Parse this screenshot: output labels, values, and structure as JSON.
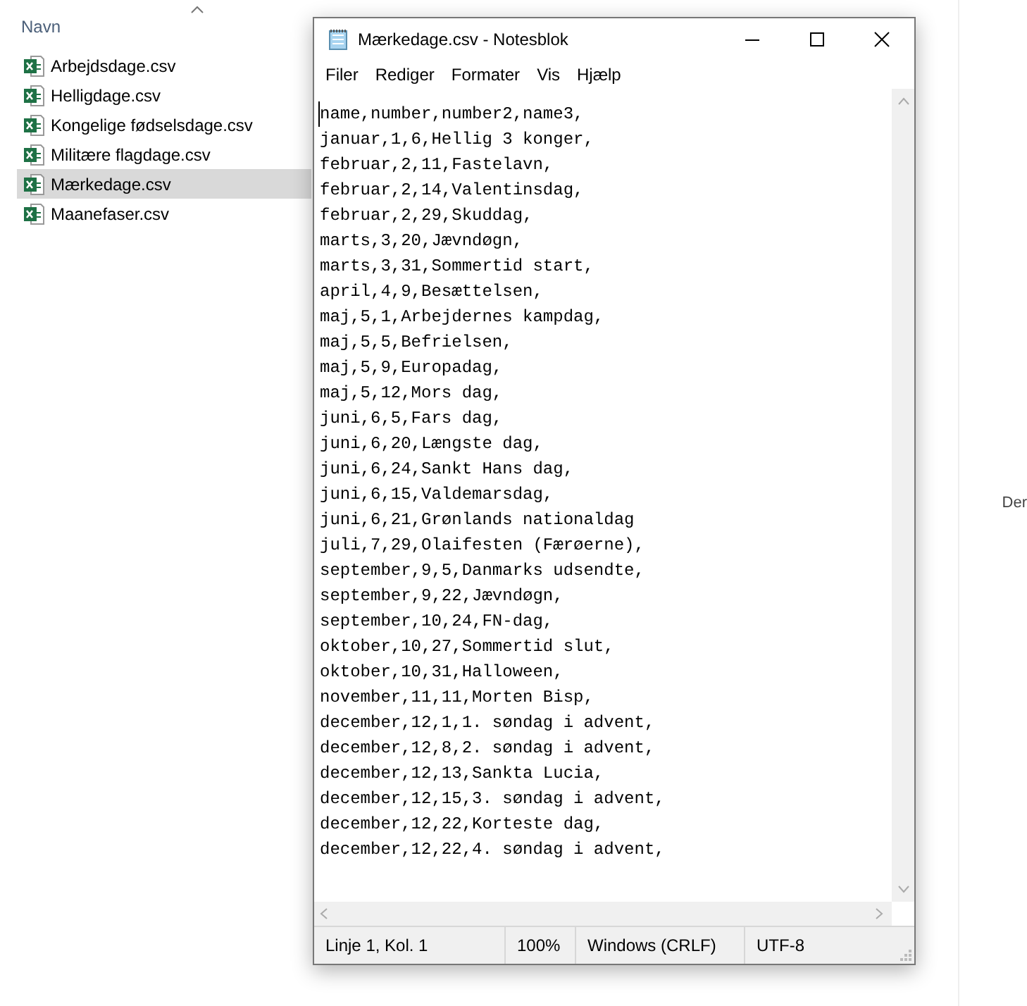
{
  "explorer": {
    "column_header": "Navn",
    "files": [
      {
        "name": "Arbejdsdage.csv",
        "selected": false
      },
      {
        "name": "Helligdage.csv",
        "selected": false
      },
      {
        "name": "Kongelige fødselsdage.csv",
        "selected": false
      },
      {
        "name": "Militære flagdage.csv",
        "selected": false
      },
      {
        "name": "Mærkedage.csv",
        "selected": true
      },
      {
        "name": "Maanefaser.csv",
        "selected": false
      }
    ],
    "preview_text": "Der"
  },
  "window": {
    "title": "Mærkedage.csv - Notesblok",
    "menu": [
      "Filer",
      "Rediger",
      "Formater",
      "Vis",
      "Hjælp"
    ],
    "lines": [
      "name,number,number2,name3,",
      "januar,1,6,Hellig 3 konger,",
      "februar,2,11,Fastelavn,",
      "februar,2,14,Valentinsdag,",
      "februar,2,29,Skuddag,",
      "marts,3,20,Jævndøgn,",
      "marts,3,31,Sommertid start,",
      "april,4,9,Besættelsen,",
      "maj,5,1,Arbejdernes kampdag,",
      "maj,5,5,Befrielsen,",
      "maj,5,9,Europadag,",
      "maj,5,12,Mors dag,",
      "juni,6,5,Fars dag,",
      "juni,6,20,Længste dag,",
      "juni,6,24,Sankt Hans dag,",
      "juni,6,15,Valdemarsdag,",
      "juni,6,21,Grønlands nationaldag",
      "juli,7,29,Olaifesten (Færøerne),",
      "september,9,5,Danmarks udsendte,",
      "september,9,22,Jævndøgn,",
      "september,10,24,FN-dag,",
      "oktober,10,27,Sommertid slut,",
      "oktober,10,31,Halloween,",
      "november,11,11,Morten Bisp,",
      "december,12,1,1. søndag i advent,",
      "december,12,8,2. søndag i advent,",
      "december,12,13,Sankta Lucia,",
      "december,12,15,3. søndag i advent,",
      "december,12,22,Korteste dag,",
      "december,12,22,4. søndag i advent,"
    ],
    "status_bar": [
      "Linje 1, Kol. 1",
      "100%",
      "Windows (CRLF)",
      "UTF-8"
    ]
  }
}
